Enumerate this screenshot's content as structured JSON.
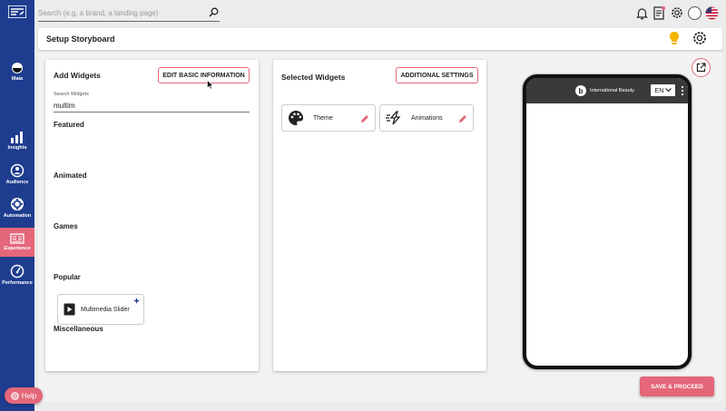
{
  "sidebar": {
    "items": [
      {
        "label": "Maia",
        "icon": "maia-icon"
      },
      {
        "label": "Insights",
        "icon": "bar-chart-icon"
      },
      {
        "label": "Audience",
        "icon": "audience-icon"
      },
      {
        "label": "Automation",
        "icon": "automation-gear-icon"
      },
      {
        "label": "Experience",
        "icon": "experience-card-icon",
        "active": true
      },
      {
        "label": "Performance",
        "icon": "gauge-icon"
      }
    ],
    "help_label": "Help"
  },
  "topbar": {
    "search_placeholder": "Search (e.g. a brand, a landing page)",
    "icons": [
      "bell-icon",
      "clipboard-icon",
      "gear-icon",
      "profile-circle-icon",
      "us-flag-icon"
    ]
  },
  "header": {
    "title": "Setup Storyboard"
  },
  "add_widgets": {
    "title": "Add Widgets",
    "edit_button": "EDIT BASIC INFORMATION",
    "search_label": "Search Widgets",
    "search_value": "multim",
    "sections": {
      "featured": "Featured",
      "animated": "Animated",
      "games": "Games",
      "popular": "Popular",
      "miscellaneous": "Miscellaneous"
    },
    "popular_widget": "Multimedia Slider"
  },
  "selected_widgets": {
    "title": "Selected Widgets",
    "settings_button": "ADDITIONAL SETTINGS",
    "items": [
      {
        "label": "Theme",
        "icon": "palette-icon"
      },
      {
        "label": "Animations",
        "icon": "animation-bolt-icon"
      }
    ]
  },
  "preview": {
    "brand_name": "International Beauty",
    "language": "EN"
  },
  "save_button": "SAVE & PROCEED",
  "colors": {
    "sidebar": "#1e3d8f",
    "accent": "#e4677a"
  }
}
